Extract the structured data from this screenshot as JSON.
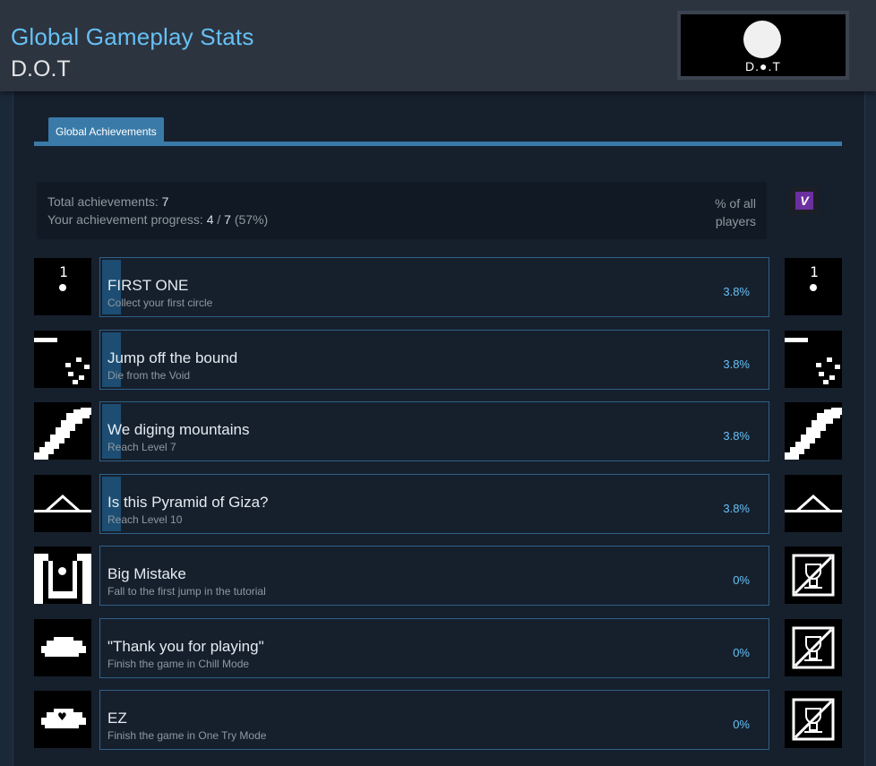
{
  "header": {
    "title": "Global Gameplay Stats",
    "game_name": "D.O.T",
    "logo_text": "D.●.T"
  },
  "tabs": [
    {
      "label": "Global Achievements",
      "active": true
    }
  ],
  "summary": {
    "total_label": "Total achievements:",
    "total_value": "7",
    "progress_label": "Your achievement progress:",
    "progress_unlocked": "4",
    "progress_sep": "/",
    "progress_total": "7",
    "progress_pct": "(57%)",
    "pct_header_line1": "% of all",
    "pct_header_line2": "players"
  },
  "user_badge": {
    "letter": "V",
    "icon": "user-avatar-icon"
  },
  "achievements": [
    {
      "name": "FIRST ONE",
      "description": "Collect your first circle",
      "percent": "3.8%",
      "percent_value": 3.8,
      "icon": "first-circle-icon",
      "unlocked": true
    },
    {
      "name": "Jump off the bound",
      "description": "Die from the Void",
      "percent": "3.8%",
      "percent_value": 3.8,
      "icon": "void-icon",
      "unlocked": true
    },
    {
      "name": "We diging mountains",
      "description": "Reach Level 7",
      "percent": "3.8%",
      "percent_value": 3.8,
      "icon": "stairs-icon",
      "unlocked": true
    },
    {
      "name": "Is this Pyramid of Giza?",
      "description": "Reach Level 10",
      "percent": "3.8%",
      "percent_value": 3.8,
      "icon": "pyramid-icon",
      "unlocked": true
    },
    {
      "name": "Big Mistake",
      "description": "Fall to the first jump in the tutorial",
      "percent": "0%",
      "percent_value": 0,
      "icon": "pit-icon",
      "unlocked": false
    },
    {
      "name": "\"Thank you for playing\"",
      "description": "Finish the game in Chill Mode",
      "percent": "0%",
      "percent_value": 0,
      "icon": "cloud-icon",
      "unlocked": false
    },
    {
      "name": "EZ",
      "description": "Finish the game in One Try Mode",
      "percent": "0%",
      "percent_value": 0,
      "icon": "heart-cloud-icon",
      "unlocked": false
    }
  ],
  "locked_icon": "locked-trophy-icon",
  "colors": {
    "accent": "#66c0f4",
    "tab": "#3a7aa8",
    "bar": "#1d4d72"
  }
}
